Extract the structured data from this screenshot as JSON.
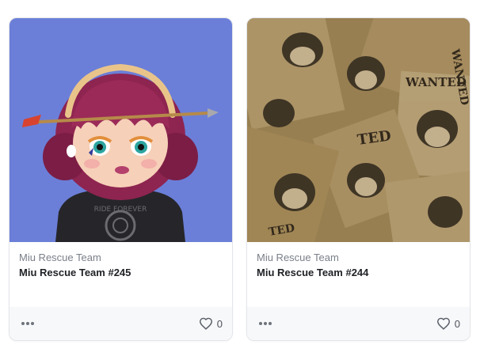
{
  "cards": [
    {
      "collection": "Miu Rescue Team",
      "title": "Miu Rescue Team #245",
      "likes": "0",
      "background": "#6b7fd8",
      "image": "cartoon-girl-with-arrow-headband"
    },
    {
      "collection": "Miu Rescue Team",
      "title": "Miu Rescue Team #244",
      "likes": "0",
      "background": "#a58c5a",
      "image": "wanted-posters-collage",
      "poster_texts": [
        "WANTED",
        "WANTED",
        "TED",
        "TED"
      ]
    }
  ],
  "icons": {
    "more": "more-dots-icon",
    "like": "heart-outline-icon"
  }
}
